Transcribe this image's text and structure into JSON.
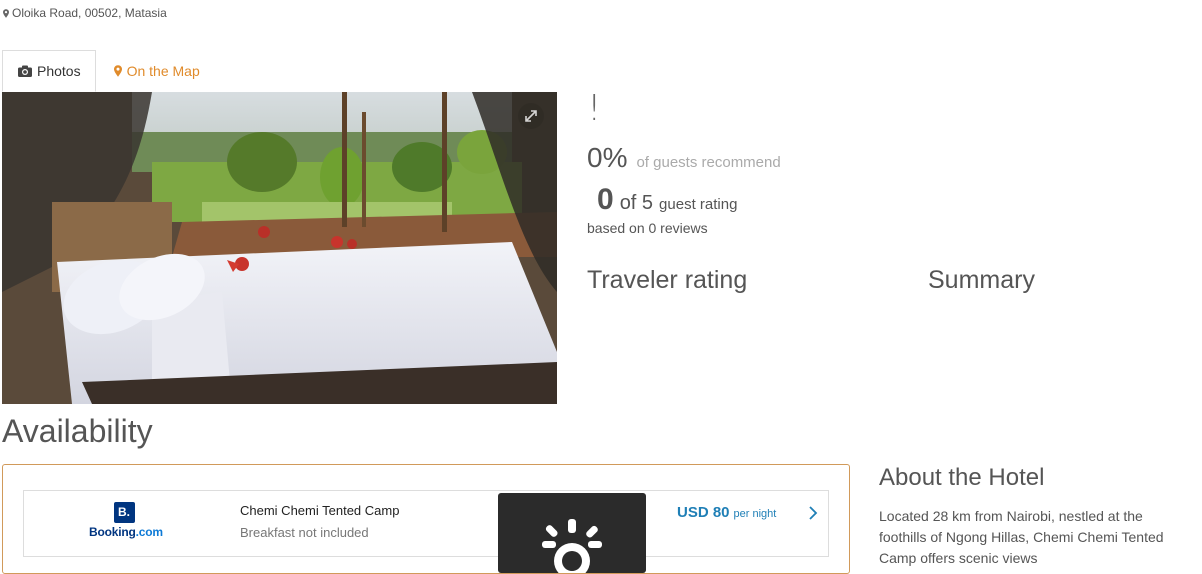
{
  "address": "Oloika Road, 00502, Matasia",
  "tabs": [
    {
      "label": "Photos",
      "icon": "camera-icon"
    },
    {
      "label": "On the Map",
      "icon": "map-pin-icon"
    }
  ],
  "rating": {
    "exclamation": "!",
    "recommend_pct": "0%",
    "recommend_label": "of guests recommend",
    "score": "0",
    "score_of": "of 5",
    "score_label": "guest rating",
    "based_on": "based on 0 reviews",
    "traveler_rating_title": "Traveler rating",
    "summary_title": "Summary"
  },
  "availability": {
    "title": "Availability",
    "offer": {
      "provider_logo_letter": "B.",
      "provider_name_main": "Booking",
      "provider_name_suffix": ".com",
      "hotel_name": "Chemi Chemi Tented Camp",
      "meal": "Breakfast not included",
      "price": "USD 80",
      "price_unit": "per night"
    }
  },
  "about": {
    "title": "About the Hotel",
    "text": "Located 28 km from Nairobi, nestled at the foothills of Ngong Hillas, Chemi Chemi Tented Camp offers scenic views"
  },
  "colors": {
    "accent_orange": "#e08b2b",
    "price_blue": "#1f7fb6",
    "booking_blue": "#003580"
  }
}
